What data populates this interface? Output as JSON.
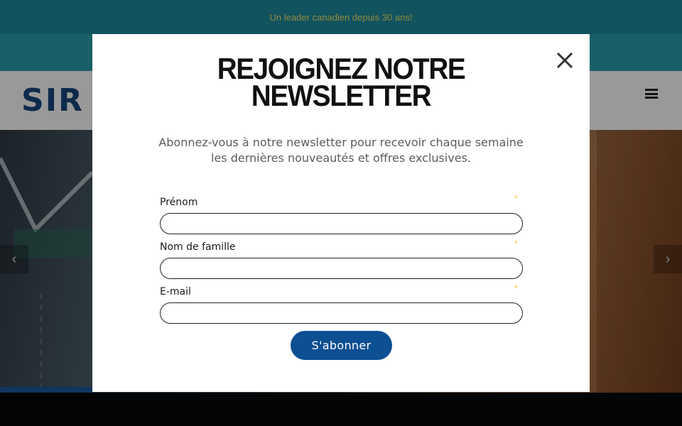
{
  "top_banner": {
    "tagline": "Un leader canadien depuis 30 ans!"
  },
  "header": {
    "logo_text": "SIR",
    "menu_icon": "hamburger-menu-icon"
  },
  "hero": {
    "prev_icon": "chevron-left-icon",
    "next_icon": "chevron-right-icon",
    "prev_glyph": "‹",
    "next_glyph": "›"
  },
  "newsletter": {
    "close_icon": "close-icon",
    "title_line1": "REJOIGNEZ NOTRE",
    "title_line2": "NEWSLETTER",
    "description": "Abonnez-vous à notre newsletter pour recevoir chaque semaine les dernières nouveautés et offres exclusives.",
    "fields": [
      {
        "label": "Prénom",
        "required_mark": "*",
        "value": ""
      },
      {
        "label": "Nom de famille",
        "required_mark": "*",
        "value": ""
      },
      {
        "label": "E-mail",
        "required_mark": "*",
        "value": ""
      }
    ],
    "submit_label": "S'abonner"
  },
  "colors": {
    "topbar": "#1d8b9d",
    "tagline": "#f3e36a",
    "logo": "#17467f",
    "submit_button": "#0d4f93",
    "required_mark": "#f2c200"
  }
}
